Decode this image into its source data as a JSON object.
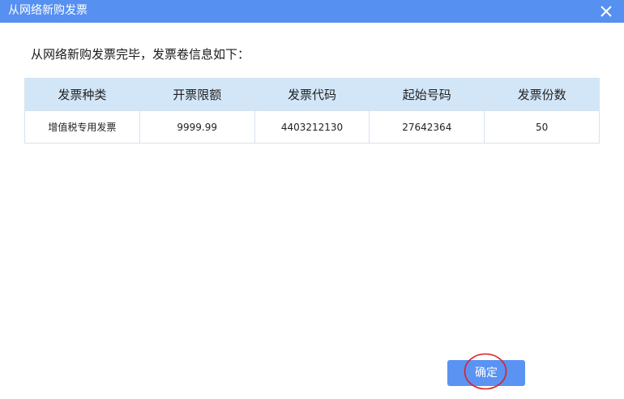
{
  "window": {
    "title": "从网络新购发票",
    "close_icon": "close-icon"
  },
  "message": "从网络新购发票完毕，发票卷信息如下：",
  "table": {
    "columns": [
      "发票种类",
      "开票限额",
      "发票代码",
      "起始号码",
      "发票份数"
    ],
    "rows": [
      [
        "增值税专用发票",
        "9999.99",
        "4403212130",
        "27642364",
        "50"
      ]
    ]
  },
  "buttons": {
    "ok_label": "确定"
  },
  "colors": {
    "titlebar": "#5690f0",
    "header_bg": "#d2e6f8",
    "button": "#5a93f2",
    "annotation": "#e02020"
  }
}
